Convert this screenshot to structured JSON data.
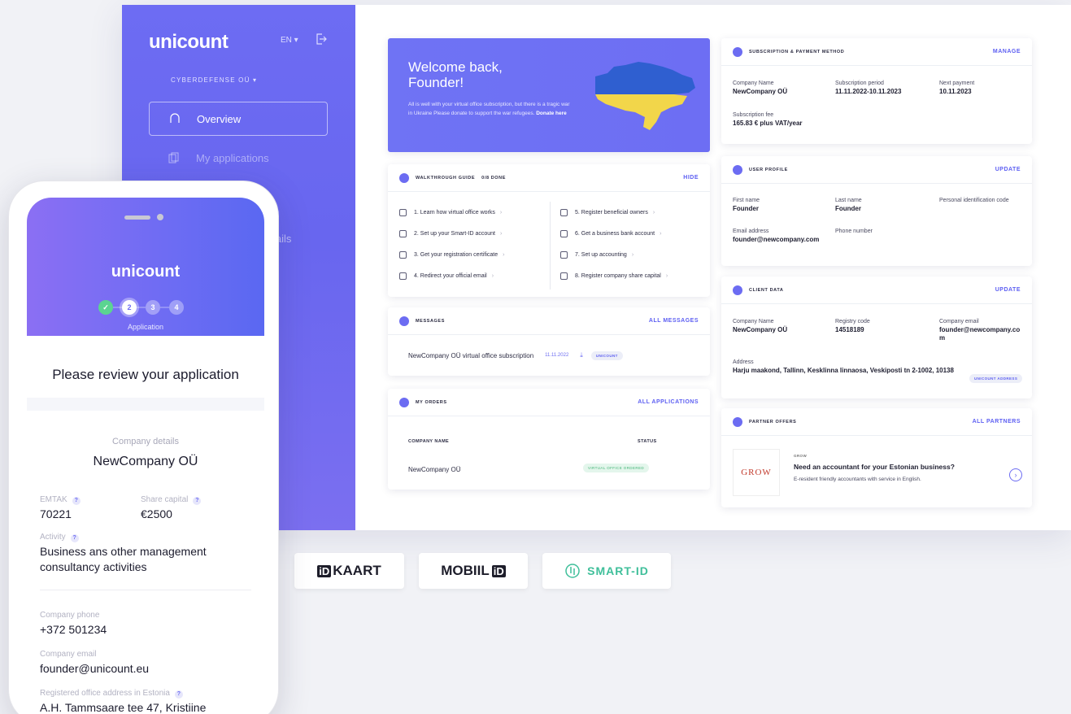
{
  "sidebar": {
    "brand": "unicount",
    "lang": "EN ▾",
    "company": "CYBERDEFENSE OÜ ▾",
    "nav": [
      {
        "label": "Overview"
      },
      {
        "label": "My applications"
      }
    ],
    "nav_fragment": "etails"
  },
  "welcome": {
    "title": "Welcome back, Founder!",
    "body": "All is well with your virtual office subscription, but there is a tragic war in Ukraine Please donate to support the war refugees.",
    "donate": "Donate here",
    "colors": {
      "flag_blue": "#2f5fd0",
      "flag_yellow": "#f2d64a"
    }
  },
  "walkthrough": {
    "title": "WALKTHROUGH GUIDE",
    "progress": "0/8 DONE",
    "action": "HIDE",
    "items_left": [
      "1. Learn how virtual office works",
      "2. Set up your Smart-ID account",
      "3. Get your registration certificate",
      "4. Redirect your official email"
    ],
    "items_right": [
      "5. Register beneficial owners",
      "6. Get a business bank account",
      "7. Set up accounting",
      "8. Register company share capital"
    ]
  },
  "messages": {
    "title": "MESSAGES",
    "action": "ALL MESSAGES",
    "row": {
      "subject": "NewCompany OÜ virtual office subscription",
      "date": "11.11.2022",
      "badge": "UNICOUNT"
    }
  },
  "orders": {
    "title": "MY ORDERS",
    "action": "ALL APPLICATIONS",
    "col_name": "COMPANY NAME",
    "col_status": "STATUS",
    "row": {
      "name": "NewCompany OÜ",
      "status": "VIRTUAL OFFICE ORDERED"
    }
  },
  "subscription": {
    "title": "SUBSCRIPTION & PAYMENT METHOD",
    "action": "MANAGE",
    "company_label": "Company Name",
    "company": "NewCompany OÜ",
    "period_label": "Subscription period",
    "period": "11.11.2022-10.11.2023",
    "next_label": "Next payment",
    "next": "10.11.2023",
    "fee_label": "Subscription fee",
    "fee": "165.83 € plus VAT/year"
  },
  "profile": {
    "title": "USER PROFILE",
    "action": "UPDATE",
    "first_label": "First name",
    "first": "Founder",
    "last_label": "Last name",
    "last": "Founder",
    "pid_label": "Personal identification code",
    "email_label": "Email address",
    "email": "founder@newcompany.com",
    "phone_label": "Phone number"
  },
  "client": {
    "title": "CLIENT DATA",
    "action": "UPDATE",
    "company_label": "Company Name",
    "company": "NewCompany OÜ",
    "reg_label": "Registry code",
    "reg": "14518189",
    "email_label": "Company email",
    "email": "founder@newcompany.com",
    "addr_label": "Address",
    "addr": "Harju maakond, Tallinn, Kesklinna linnaosa, Veskiposti tn 2-1002, 10138",
    "addr_badge": "UNICOUNT ADDRESS"
  },
  "partner": {
    "title": "PARTNER OFFERS",
    "action": "ALL PARTNERS",
    "logo": "GROW",
    "tag": "GROW",
    "offer_title": "Need an accountant for your Estonian business?",
    "offer_desc": "E-resident friendly accountants with service in English."
  },
  "auth": {
    "idkaart_mark": "iD",
    "idkaart_text": "KAART",
    "mobiil_text": "MOBIIL",
    "mobiil_mark": "iD",
    "smartid_text": "SMART-ID",
    "smartid_color": "#3fbf9a"
  },
  "phone": {
    "brand": "unicount",
    "steps": [
      "✓",
      "2",
      "3",
      "4"
    ],
    "step_label": "Application",
    "review_title": "Please review your application",
    "cd_label": "Company details",
    "cd_value": "NewCompany OÜ",
    "emtak_label": "EMTAK",
    "emtak": "70221",
    "share_label": "Share capital",
    "share": "€2500",
    "activity_label": "Activity",
    "activity": "Business ans other management consultancy activities",
    "phone_label": "Company phone",
    "phone": "+372 501234",
    "email_label": "Company email",
    "email": "founder@unicount.eu",
    "addr_label": "Registered office address in Estonia",
    "addr": "A.H. Tammsaare tee 47, Kristiine",
    "help": "?"
  }
}
